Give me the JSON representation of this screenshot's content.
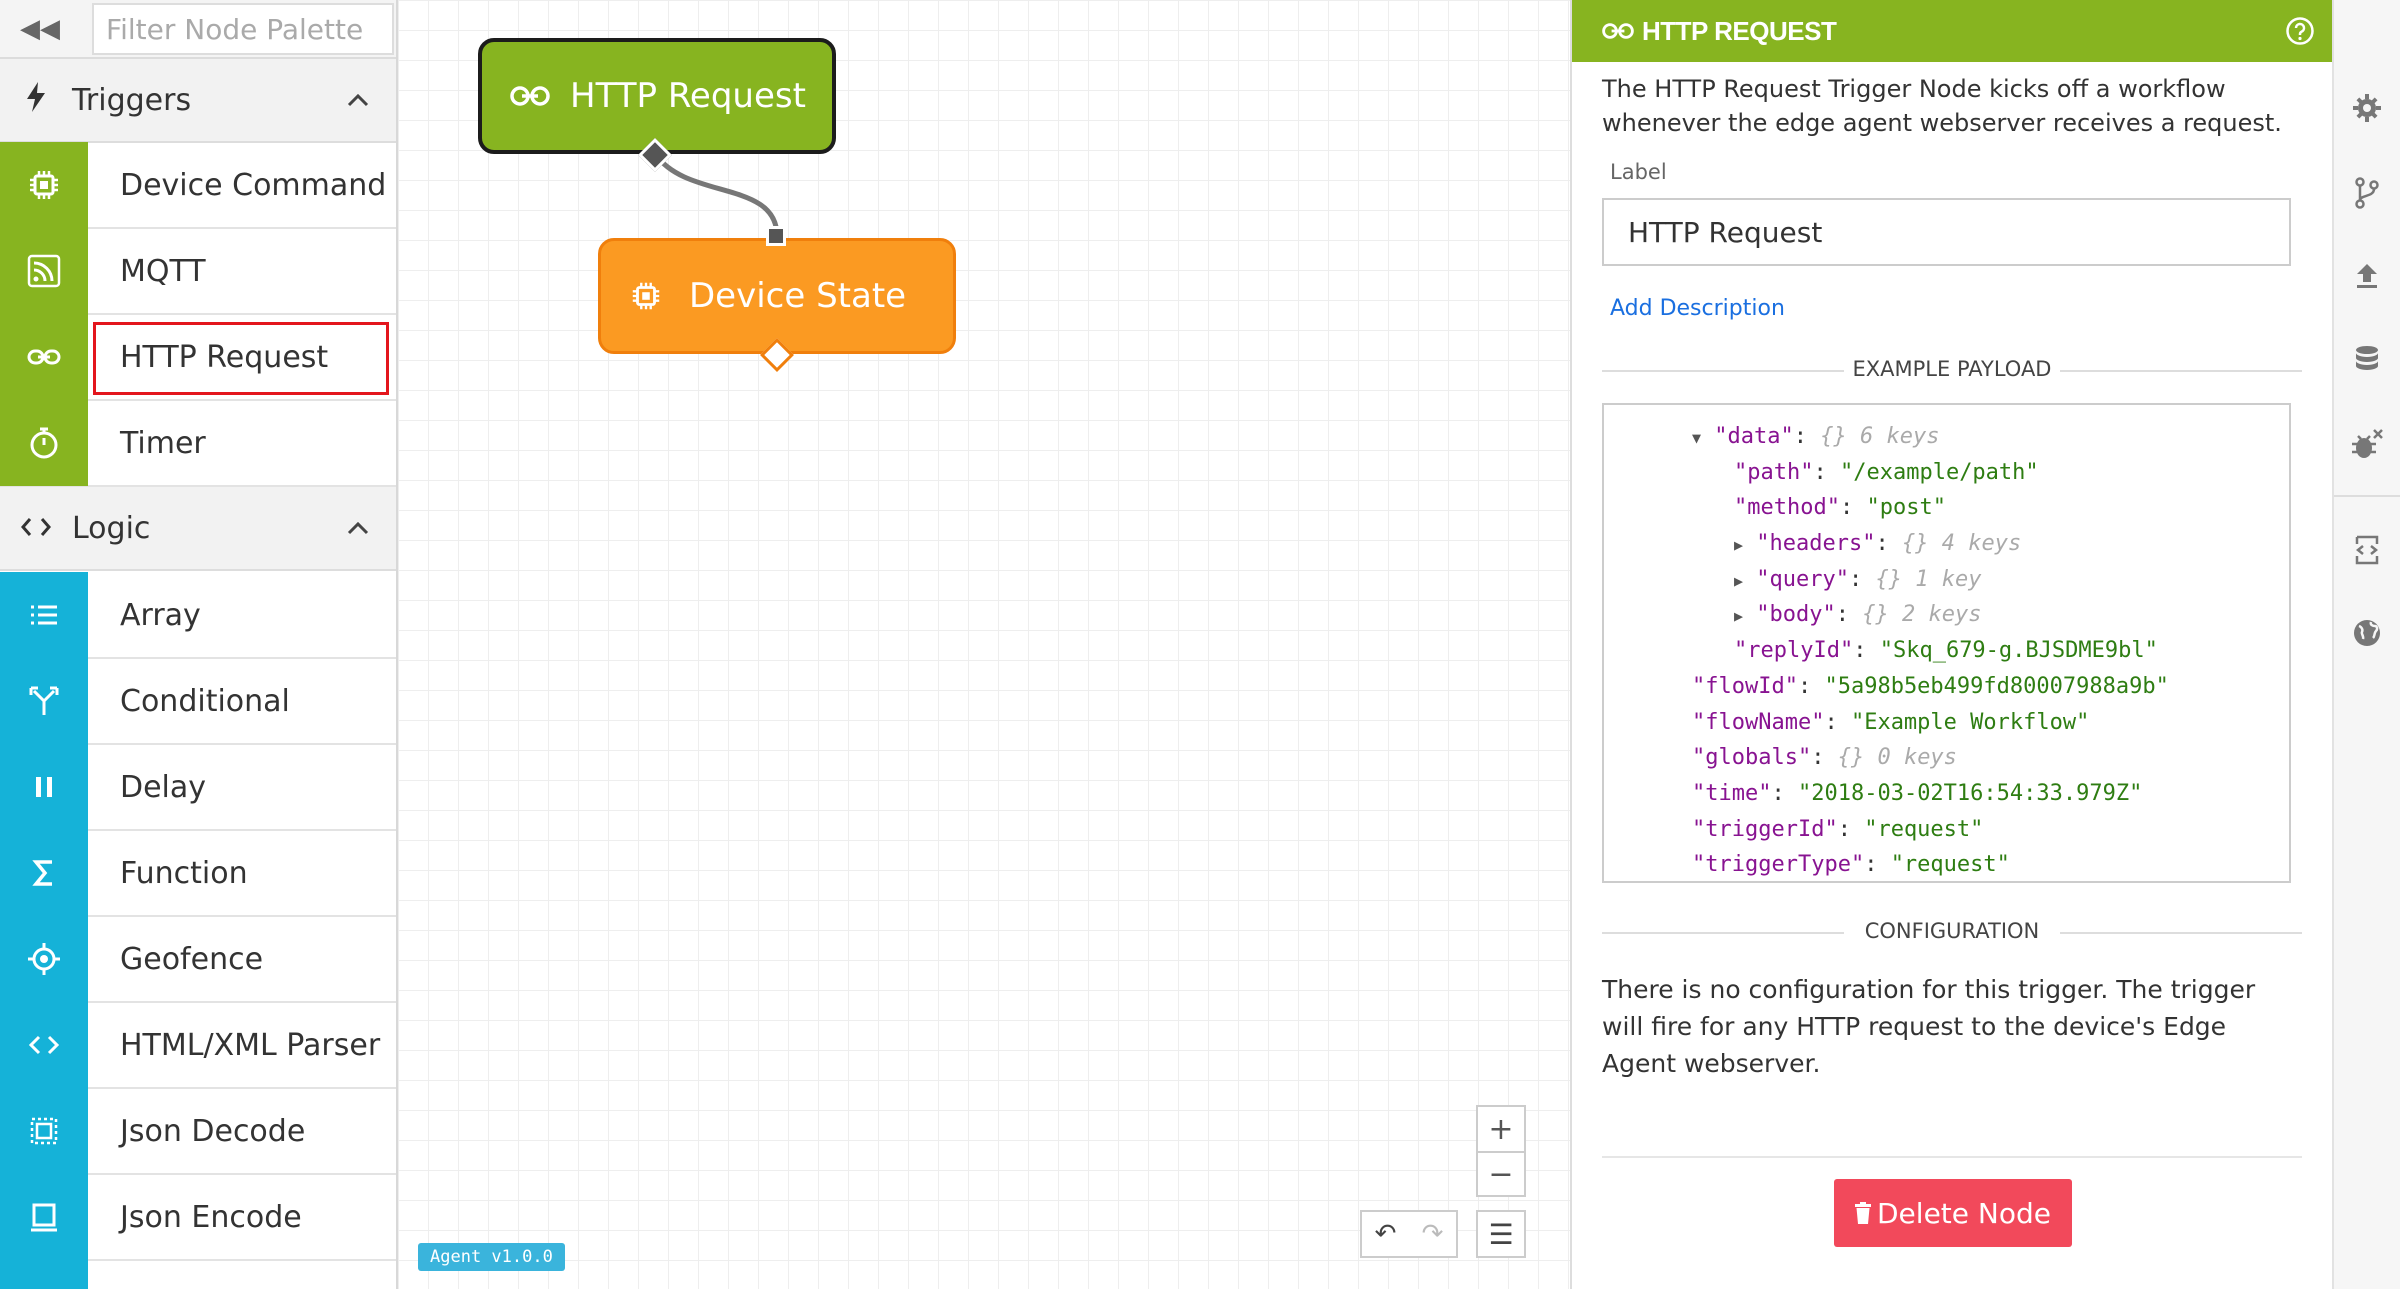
{
  "palette": {
    "filter_placeholder": "Filter Node Palette",
    "categories": [
      {
        "label": "Triggers",
        "items": [
          "Device Command",
          "MQTT",
          "HTTP Request",
          "Timer"
        ]
      },
      {
        "label": "Logic",
        "items": [
          "Array",
          "Conditional",
          "Delay",
          "Function",
          "Geofence",
          "HTML/XML Parser",
          "Json Decode",
          "Json Encode"
        ]
      }
    ],
    "selected_item": "HTTP Request"
  },
  "canvas": {
    "nodes": [
      {
        "label": "HTTP Request",
        "color": "#87b420"
      },
      {
        "label": "Device State",
        "color": "#fb9a22"
      }
    ],
    "zoom_in": "+",
    "zoom_out": "−",
    "agent_version": "Agent v1.0.0"
  },
  "panel": {
    "title": "HTTP REQUEST",
    "description": "The HTTP Request Trigger Node kicks off a workflow whenever the edge agent webserver receives a request.",
    "label_caption": "Label",
    "label_value": "HTTP Request",
    "add_description": "Add Description",
    "example_payload_title": "EXAMPLE PAYLOAD",
    "payload": {
      "data_key": "\"data\"",
      "data_meta": "{} 6 keys",
      "path_key": "\"path\"",
      "path_val": "\"/example/path\"",
      "method_key": "\"method\"",
      "method_val": "\"post\"",
      "headers_key": "\"headers\"",
      "headers_meta": "{} 4 keys",
      "query_key": "\"query\"",
      "query_meta": "{} 1 key",
      "body_key": "\"body\"",
      "body_meta": "{} 2 keys",
      "replyId_key": "\"replyId\"",
      "replyId_val": "\"Skq_679-g.BJSDME9bl\"",
      "flowId_key": "\"flowId\"",
      "flowId_val": "\"5a98b5eb499fd80007988a9b\"",
      "flowName_key": "\"flowName\"",
      "flowName_val": "\"Example Workflow\"",
      "globals_key": "\"globals\"",
      "globals_meta": "{} 0 keys",
      "time_key": "\"time\"",
      "time_val": "\"2018-03-02T16:54:33.979Z\"",
      "triggerId_key": "\"triggerId\"",
      "triggerId_val": "\"request\"",
      "triggerType_key": "\"triggerType\"",
      "triggerType_val": "\"request\""
    },
    "configuration_title": "CONFIGURATION",
    "configuration_text": "There is no configuration for this trigger. The trigger will fire for any HTTP request to the device's Edge Agent webserver.",
    "delete_label": "Delete Node"
  },
  "colors": {
    "trigger_green": "#87b420",
    "logic_blue": "#15b2d8",
    "state_orange": "#fb9a22",
    "delete_red": "#f2495b",
    "selection_red": "#e3161d"
  }
}
